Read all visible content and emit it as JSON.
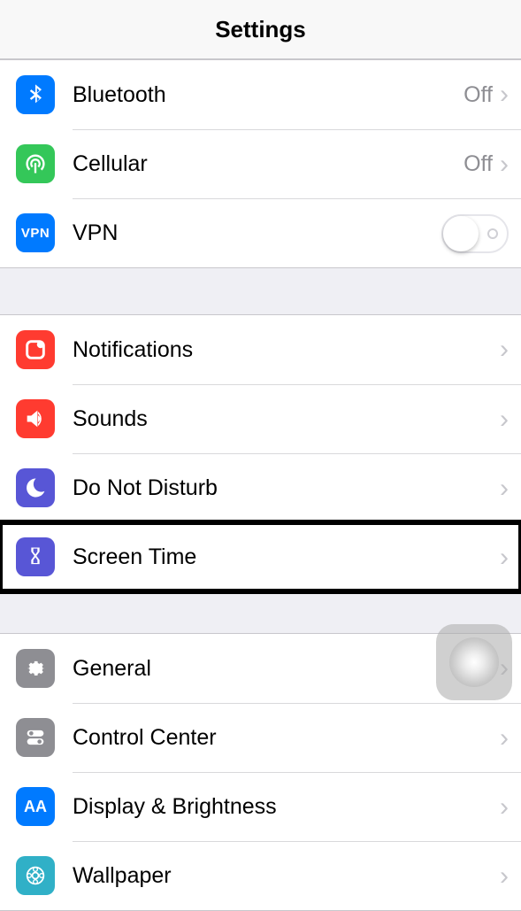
{
  "header": {
    "title": "Settings"
  },
  "group1": {
    "bluetooth": {
      "label": "Bluetooth",
      "value": "Off"
    },
    "cellular": {
      "label": "Cellular",
      "value": "Off"
    },
    "vpn": {
      "label": "VPN"
    }
  },
  "group2": {
    "notifications": {
      "label": "Notifications"
    },
    "sounds": {
      "label": "Sounds"
    },
    "dnd": {
      "label": "Do Not Disturb"
    },
    "screentime": {
      "label": "Screen Time"
    }
  },
  "group3": {
    "general": {
      "label": "General"
    },
    "control": {
      "label": "Control Center"
    },
    "display": {
      "label": "Display & Brightness"
    },
    "wallpaper": {
      "label": "Wallpaper"
    }
  },
  "icons": {
    "vpn_text": "VPN",
    "aa_text": "AA"
  },
  "colors": {
    "blue": "#007aff",
    "green": "#34c759",
    "orange": "#ff3b30",
    "red": "#ff3b30",
    "indigo": "#5856d6",
    "gray": "#8e8e93",
    "teal": "#30b0c7"
  }
}
